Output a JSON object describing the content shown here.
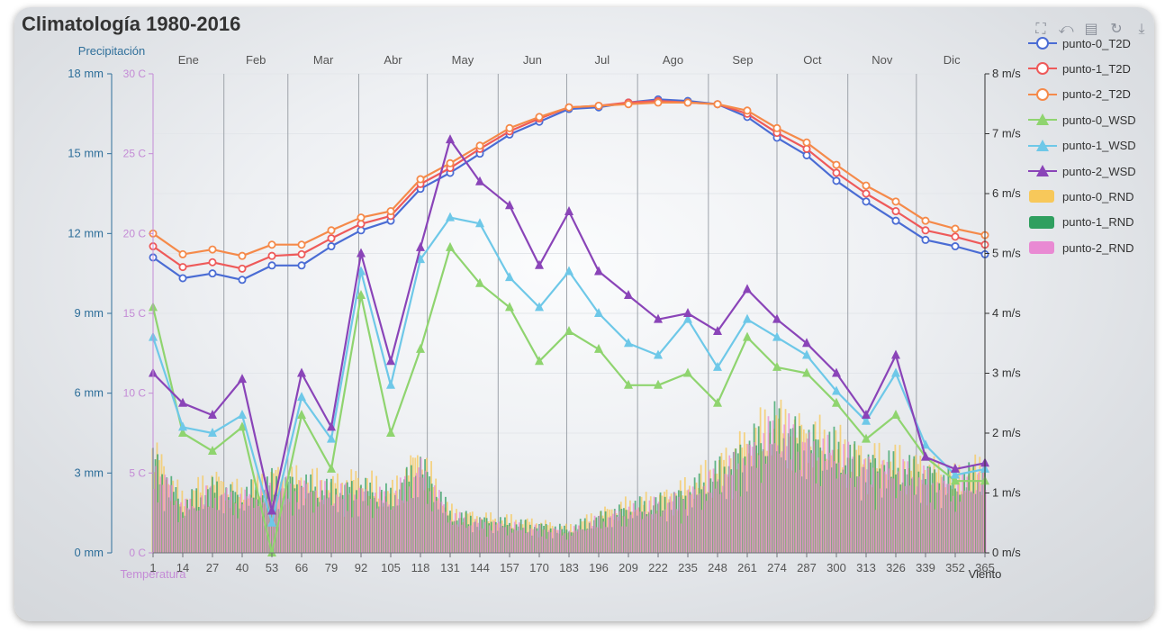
{
  "title": "Climatología 1980-2016",
  "toolbox": [
    {
      "name": "zoom-icon",
      "glyph": "⛶"
    },
    {
      "name": "zoom-reset-icon",
      "glyph": "⤺"
    },
    {
      "name": "data-view-icon",
      "glyph": "▤"
    },
    {
      "name": "restore-icon",
      "glyph": "↻"
    },
    {
      "name": "download-icon",
      "glyph": "⤓"
    }
  ],
  "colors": {
    "precip_axis": "#2f6f9a",
    "temp_axis": "#c48bd6",
    "wind_axis": "#333333",
    "grid": "#cfd3d8"
  },
  "chart_data": {
    "type": "line",
    "title": "Climatología 1980-2016",
    "axes": {
      "precip": {
        "name": "Precipitación",
        "min": 0,
        "max": 18,
        "ticks": [
          "0 mm",
          "3 mm",
          "6 mm",
          "9 mm",
          "12 mm",
          "15 mm",
          "18 mm"
        ]
      },
      "temp": {
        "name": "Temperatura",
        "min": 0,
        "max": 30,
        "ticks": [
          "0 C",
          "5 C",
          "10 C",
          "15 C",
          "20 C",
          "25 C",
          "30 C"
        ]
      },
      "wind": {
        "name": "Viento",
        "min": 0,
        "max": 8,
        "ticks": [
          "0 m/s",
          "1 m/s",
          "2 m/s",
          "3 m/s",
          "4 m/s",
          "5 m/s",
          "6 m/s",
          "7 m/s",
          "8 m/s"
        ]
      },
      "x": {
        "min": 1,
        "max": 365,
        "ticks": [
          "1",
          "14",
          "27",
          "40",
          "53",
          "66",
          "79",
          "92",
          "105",
          "118",
          "131",
          "144",
          "157",
          "170",
          "183",
          "196",
          "209",
          "222",
          "235",
          "248",
          "261",
          "274",
          "287",
          "300",
          "313",
          "326",
          "339",
          "352",
          "365"
        ]
      }
    },
    "months": [
      "Ene",
      "Feb",
      "Mar",
      "Abr",
      "May",
      "Jun",
      "Jul",
      "Ago",
      "Sep",
      "Oct",
      "Nov",
      "Dic"
    ],
    "legend_position": "right",
    "grid": true,
    "series_colors": {
      "punto-0_T2D": "#4a6cd4",
      "punto-0_WSD": "#8fd46f",
      "punto-0_RND": "#f7c85a",
      "punto-1_T2D": "#ee5a5a",
      "punto-1_WSD": "#6ec8e8",
      "punto-1_RND": "#2f9f5f",
      "punto-2_T2D": "#f58a4a",
      "punto-2_WSD": "#8a44b8",
      "punto-2_RND": "#e98ad3"
    },
    "series": [
      {
        "name": "punto-0_T2D",
        "axis": "temp",
        "kind": "line",
        "symbol": "circle",
        "points": [
          [
            1,
            18.5
          ],
          [
            14,
            17.2
          ],
          [
            27,
            17.5
          ],
          [
            40,
            17.1
          ],
          [
            53,
            18.0
          ],
          [
            66,
            18.0
          ],
          [
            79,
            19.2
          ],
          [
            92,
            20.2
          ],
          [
            105,
            20.8
          ],
          [
            118,
            22.8
          ],
          [
            131,
            23.8
          ],
          [
            144,
            25.0
          ],
          [
            157,
            26.2
          ],
          [
            170,
            27.0
          ],
          [
            183,
            27.8
          ],
          [
            196,
            27.9
          ],
          [
            209,
            28.2
          ],
          [
            222,
            28.4
          ],
          [
            235,
            28.3
          ],
          [
            248,
            28.1
          ],
          [
            261,
            27.3
          ],
          [
            274,
            26.0
          ],
          [
            287,
            24.9
          ],
          [
            300,
            23.3
          ],
          [
            313,
            22.0
          ],
          [
            326,
            20.8
          ],
          [
            339,
            19.6
          ],
          [
            352,
            19.2
          ],
          [
            365,
            18.7
          ]
        ]
      },
      {
        "name": "punto-1_T2D",
        "axis": "temp",
        "kind": "line",
        "symbol": "circle",
        "points": [
          [
            1,
            19.2
          ],
          [
            14,
            17.9
          ],
          [
            27,
            18.2
          ],
          [
            40,
            17.8
          ],
          [
            53,
            18.6
          ],
          [
            66,
            18.7
          ],
          [
            79,
            19.7
          ],
          [
            92,
            20.6
          ],
          [
            105,
            21.1
          ],
          [
            118,
            23.1
          ],
          [
            131,
            24.1
          ],
          [
            144,
            25.3
          ],
          [
            157,
            26.4
          ],
          [
            170,
            27.2
          ],
          [
            183,
            27.9
          ],
          [
            196,
            28.0
          ],
          [
            209,
            28.2
          ],
          [
            222,
            28.3
          ],
          [
            235,
            28.2
          ],
          [
            248,
            28.1
          ],
          [
            261,
            27.5
          ],
          [
            274,
            26.3
          ],
          [
            287,
            25.3
          ],
          [
            300,
            23.8
          ],
          [
            313,
            22.5
          ],
          [
            326,
            21.4
          ],
          [
            339,
            20.2
          ],
          [
            352,
            19.8
          ],
          [
            365,
            19.3
          ]
        ]
      },
      {
        "name": "punto-2_T2D",
        "axis": "temp",
        "kind": "line",
        "symbol": "circle",
        "points": [
          [
            1,
            20.0
          ],
          [
            14,
            18.7
          ],
          [
            27,
            19.0
          ],
          [
            40,
            18.6
          ],
          [
            53,
            19.3
          ],
          [
            66,
            19.3
          ],
          [
            79,
            20.2
          ],
          [
            92,
            21.0
          ],
          [
            105,
            21.4
          ],
          [
            118,
            23.4
          ],
          [
            131,
            24.4
          ],
          [
            144,
            25.5
          ],
          [
            157,
            26.6
          ],
          [
            170,
            27.3
          ],
          [
            183,
            27.9
          ],
          [
            196,
            28.0
          ],
          [
            209,
            28.1
          ],
          [
            222,
            28.2
          ],
          [
            235,
            28.2
          ],
          [
            248,
            28.1
          ],
          [
            261,
            27.7
          ],
          [
            274,
            26.6
          ],
          [
            287,
            25.7
          ],
          [
            300,
            24.3
          ],
          [
            313,
            23.0
          ],
          [
            326,
            22.0
          ],
          [
            339,
            20.8
          ],
          [
            352,
            20.3
          ],
          [
            365,
            19.9
          ]
        ]
      },
      {
        "name": "punto-0_WSD",
        "axis": "wind",
        "kind": "line",
        "symbol": "triangle",
        "points": [
          [
            1,
            4.1
          ],
          [
            14,
            2.0
          ],
          [
            27,
            1.7
          ],
          [
            40,
            2.1
          ],
          [
            53,
            0.0
          ],
          [
            66,
            2.3
          ],
          [
            79,
            1.4
          ],
          [
            92,
            4.3
          ],
          [
            105,
            2.0
          ],
          [
            118,
            3.4
          ],
          [
            131,
            5.1
          ],
          [
            144,
            4.5
          ],
          [
            157,
            4.1
          ],
          [
            170,
            3.2
          ],
          [
            183,
            3.7
          ],
          [
            196,
            3.4
          ],
          [
            209,
            2.8
          ],
          [
            222,
            2.8
          ],
          [
            235,
            3.0
          ],
          [
            248,
            2.5
          ],
          [
            261,
            3.6
          ],
          [
            274,
            3.1
          ],
          [
            287,
            3.0
          ],
          [
            300,
            2.5
          ],
          [
            313,
            1.9
          ],
          [
            326,
            2.3
          ],
          [
            339,
            1.6
          ],
          [
            352,
            1.2
          ],
          [
            365,
            1.2
          ]
        ]
      },
      {
        "name": "punto-1_WSD",
        "axis": "wind",
        "kind": "line",
        "symbol": "triangle",
        "points": [
          [
            1,
            3.6
          ],
          [
            14,
            2.1
          ],
          [
            27,
            2.0
          ],
          [
            40,
            2.3
          ],
          [
            53,
            0.5
          ],
          [
            66,
            2.6
          ],
          [
            79,
            1.9
          ],
          [
            92,
            4.7
          ],
          [
            105,
            2.8
          ],
          [
            118,
            4.9
          ],
          [
            131,
            5.6
          ],
          [
            144,
            5.5
          ],
          [
            157,
            4.6
          ],
          [
            170,
            4.1
          ],
          [
            183,
            4.7
          ],
          [
            196,
            4.0
          ],
          [
            209,
            3.5
          ],
          [
            222,
            3.3
          ],
          [
            235,
            3.9
          ],
          [
            248,
            3.1
          ],
          [
            261,
            3.9
          ],
          [
            274,
            3.6
          ],
          [
            287,
            3.3
          ],
          [
            300,
            2.7
          ],
          [
            313,
            2.2
          ],
          [
            326,
            3.0
          ],
          [
            339,
            1.8
          ],
          [
            352,
            1.3
          ],
          [
            365,
            1.4
          ]
        ]
      },
      {
        "name": "punto-2_WSD",
        "axis": "wind",
        "kind": "line",
        "symbol": "triangle",
        "points": [
          [
            1,
            3.0
          ],
          [
            14,
            2.5
          ],
          [
            27,
            2.3
          ],
          [
            40,
            2.9
          ],
          [
            53,
            0.7
          ],
          [
            66,
            3.0
          ],
          [
            79,
            2.1
          ],
          [
            92,
            5.0
          ],
          [
            105,
            3.2
          ],
          [
            118,
            5.1
          ],
          [
            131,
            6.9
          ],
          [
            144,
            6.2
          ],
          [
            157,
            5.8
          ],
          [
            170,
            4.8
          ],
          [
            183,
            5.7
          ],
          [
            196,
            4.7
          ],
          [
            209,
            4.3
          ],
          [
            222,
            3.9
          ],
          [
            235,
            4.0
          ],
          [
            248,
            3.7
          ],
          [
            261,
            4.4
          ],
          [
            274,
            3.9
          ],
          [
            287,
            3.5
          ],
          [
            300,
            3.0
          ],
          [
            313,
            2.3
          ],
          [
            326,
            3.3
          ],
          [
            339,
            1.6
          ],
          [
            352,
            1.4
          ],
          [
            365,
            1.5
          ]
        ]
      },
      {
        "name": "punto-0_RND",
        "axis": "precip",
        "kind": "bar",
        "points": [
          [
            1,
            3.5
          ],
          [
            14,
            1.8
          ],
          [
            27,
            2.5
          ],
          [
            40,
            2.0
          ],
          [
            53,
            2.6
          ],
          [
            66,
            2.5
          ],
          [
            79,
            2.3
          ],
          [
            92,
            2.5
          ],
          [
            105,
            2.0
          ],
          [
            118,
            3.3
          ],
          [
            131,
            1.4
          ],
          [
            144,
            1.2
          ],
          [
            157,
            1.1
          ],
          [
            170,
            1.0
          ],
          [
            183,
            0.8
          ],
          [
            196,
            1.3
          ],
          [
            209,
            1.6
          ],
          [
            222,
            1.8
          ],
          [
            235,
            2.2
          ],
          [
            248,
            2.9
          ],
          [
            261,
            3.7
          ],
          [
            274,
            4.5
          ],
          [
            287,
            4.0
          ],
          [
            300,
            3.7
          ],
          [
            313,
            3.2
          ],
          [
            326,
            3.1
          ],
          [
            339,
            2.9
          ],
          [
            352,
            2.5
          ],
          [
            365,
            3.0
          ]
        ]
      },
      {
        "name": "punto-1_RND",
        "axis": "precip",
        "kind": "bar",
        "points": [
          [
            1,
            3.2
          ],
          [
            14,
            1.6
          ],
          [
            27,
            2.2
          ],
          [
            40,
            1.9
          ],
          [
            53,
            2.4
          ],
          [
            66,
            2.3
          ],
          [
            79,
            2.1
          ],
          [
            92,
            2.2
          ],
          [
            105,
            1.9
          ],
          [
            118,
            3.0
          ],
          [
            131,
            1.3
          ],
          [
            144,
            1.1
          ],
          [
            157,
            1.0
          ],
          [
            170,
            0.9
          ],
          [
            183,
            0.8
          ],
          [
            196,
            1.2
          ],
          [
            209,
            1.5
          ],
          [
            222,
            1.7
          ],
          [
            235,
            2.0
          ],
          [
            248,
            2.7
          ],
          [
            261,
            3.5
          ],
          [
            274,
            4.3
          ],
          [
            287,
            3.8
          ],
          [
            300,
            3.5
          ],
          [
            313,
            3.0
          ],
          [
            326,
            2.9
          ],
          [
            339,
            2.7
          ],
          [
            352,
            2.3
          ],
          [
            365,
            2.8
          ]
        ]
      },
      {
        "name": "punto-2_RND",
        "axis": "precip",
        "kind": "bar",
        "points": [
          [
            1,
            3.0
          ],
          [
            14,
            1.5
          ],
          [
            27,
            2.0
          ],
          [
            40,
            1.8
          ],
          [
            53,
            2.2
          ],
          [
            66,
            2.2
          ],
          [
            79,
            2.0
          ],
          [
            92,
            2.0
          ],
          [
            105,
            1.8
          ],
          [
            118,
            2.8
          ],
          [
            131,
            1.2
          ],
          [
            144,
            1.0
          ],
          [
            157,
            0.9
          ],
          [
            170,
            0.8
          ],
          [
            183,
            0.7
          ],
          [
            196,
            1.1
          ],
          [
            209,
            1.4
          ],
          [
            222,
            1.6
          ],
          [
            235,
            1.9
          ],
          [
            248,
            2.5
          ],
          [
            261,
            3.3
          ],
          [
            274,
            4.1
          ],
          [
            287,
            3.6
          ],
          [
            300,
            3.3
          ],
          [
            313,
            2.8
          ],
          [
            326,
            2.7
          ],
          [
            339,
            2.5
          ],
          [
            352,
            2.1
          ],
          [
            365,
            2.6
          ]
        ]
      }
    ]
  }
}
